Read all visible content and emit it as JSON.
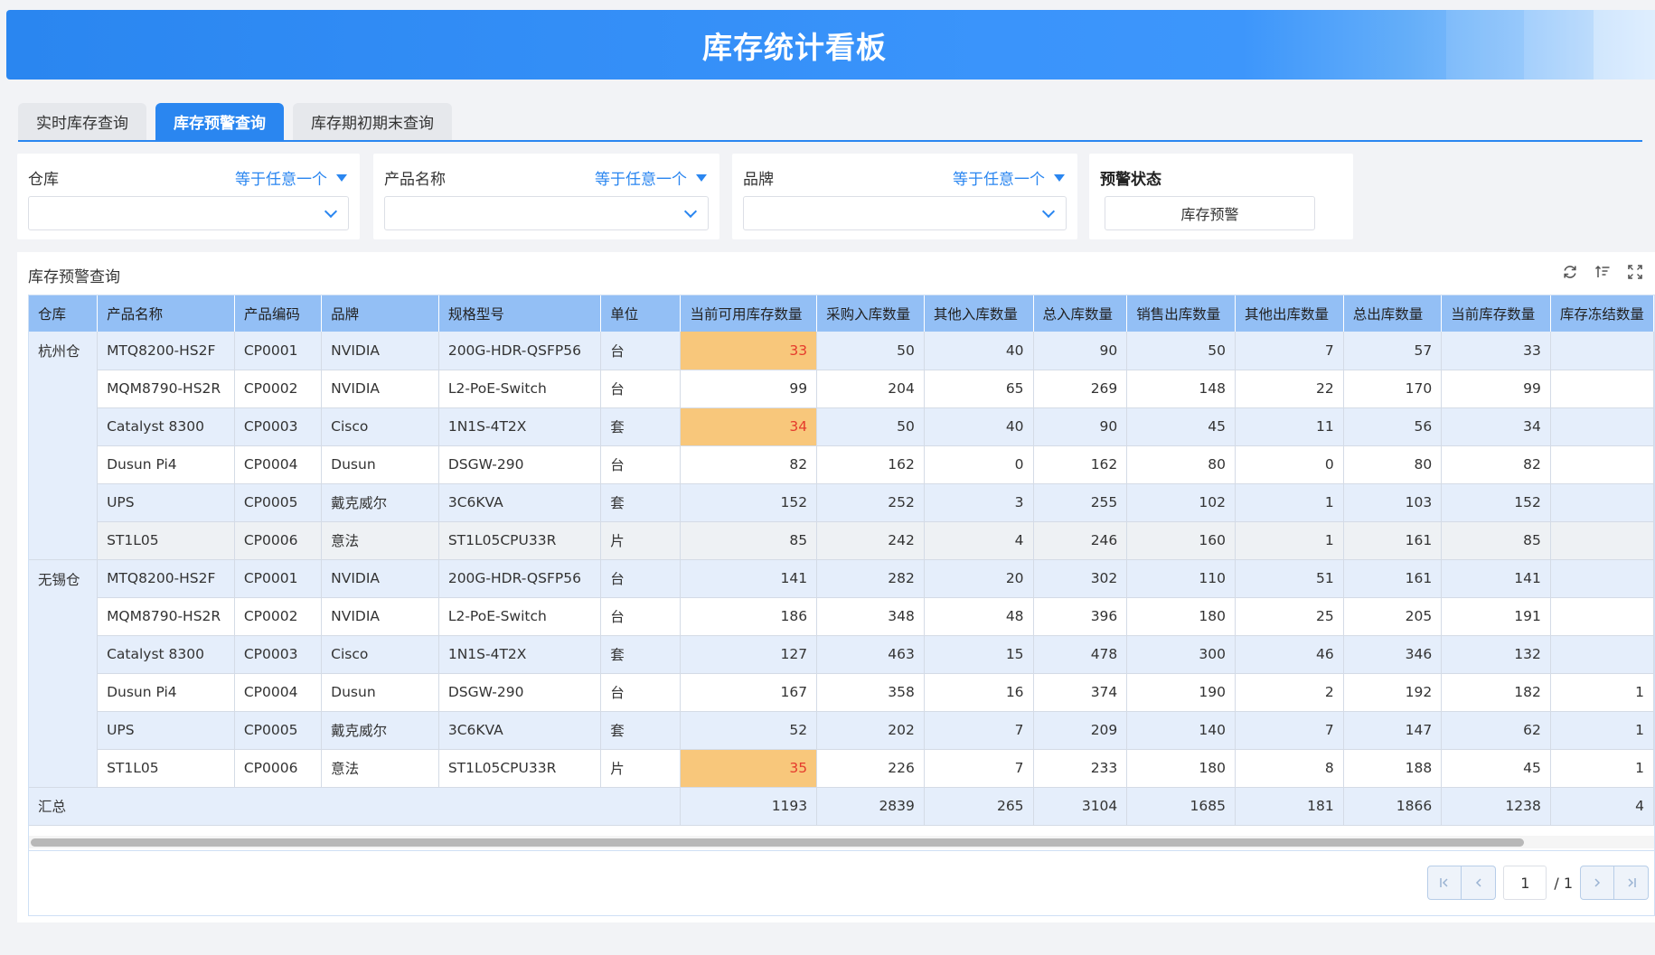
{
  "header": {
    "title": "库存统计看板"
  },
  "tabs": [
    {
      "label": "实时库存查询",
      "active": false
    },
    {
      "label": "库存预警查询",
      "active": true
    },
    {
      "label": "库存期初期末查询",
      "active": false
    }
  ],
  "filters": {
    "warehouse": {
      "label": "仓库",
      "operator": "等于任意一个",
      "value": ""
    },
    "product_name": {
      "label": "产品名称",
      "operator": "等于任意一个",
      "value": ""
    },
    "brand": {
      "label": "品牌",
      "operator": "等于任意一个",
      "value": ""
    },
    "warning_status": {
      "label": "预警状态",
      "button": "库存预警"
    }
  },
  "panel": {
    "title": "库存预警查询",
    "tools": [
      "refresh-icon",
      "sort-icon",
      "fullscreen-icon"
    ]
  },
  "colors": {
    "accent": "#2a86f0",
    "warning_bg": "#f8c77b",
    "warning_text": "#e53b2c",
    "header_bg": "#93bff5"
  },
  "table": {
    "columns": [
      "仓库",
      "产品名称",
      "产品编码",
      "品牌",
      "规格型号",
      "单位",
      "当前可用库存数量",
      "采购入库数量",
      "其他入库数量",
      "总入库数量",
      "销售出库数量",
      "其他出库数量",
      "总出库数量",
      "当前库存数量",
      "库存冻结数量"
    ],
    "groups": [
      {
        "warehouse": "杭州仓",
        "rows": [
          {
            "name": "MTQ8200-HS2F",
            "code": "CP0001",
            "brand": "NVIDIA",
            "spec": "200G-HDR-QSFP56",
            "unit": "台",
            "available": "33",
            "purchase_in": "50",
            "other_in": "40",
            "total_in": "90",
            "sales_out": "50",
            "other_out": "7",
            "total_out": "57",
            "current": "33",
            "frozen": "",
            "warn": true
          },
          {
            "name": "MQM8790-HS2R",
            "code": "CP0002",
            "brand": "NVIDIA",
            "spec": "L2-PoE-Switch",
            "unit": "台",
            "available": "99",
            "purchase_in": "204",
            "other_in": "65",
            "total_in": "269",
            "sales_out": "148",
            "other_out": "22",
            "total_out": "170",
            "current": "99",
            "frozen": "",
            "warn": false
          },
          {
            "name": "Catalyst 8300",
            "code": "CP0003",
            "brand": "Cisco",
            "spec": "1N1S-4T2X",
            "unit": "套",
            "available": "34",
            "purchase_in": "50",
            "other_in": "40",
            "total_in": "90",
            "sales_out": "45",
            "other_out": "11",
            "total_out": "56",
            "current": "34",
            "frozen": "",
            "warn": true
          },
          {
            "name": "Dusun Pi4",
            "code": "CP0004",
            "brand": "Dusun",
            "spec": "DSGW-290",
            "unit": "台",
            "available": "82",
            "purchase_in": "162",
            "other_in": "0",
            "total_in": "162",
            "sales_out": "80",
            "other_out": "0",
            "total_out": "80",
            "current": "82",
            "frozen": "",
            "warn": false
          },
          {
            "name": "UPS",
            "code": "CP0005",
            "brand": "戴克威尔",
            "spec": "3C6KVA",
            "unit": "套",
            "available": "152",
            "purchase_in": "252",
            "other_in": "3",
            "total_in": "255",
            "sales_out": "102",
            "other_out": "1",
            "total_out": "103",
            "current": "152",
            "frozen": "",
            "warn": false
          },
          {
            "name": "ST1L05",
            "code": "CP0006",
            "brand": "意法",
            "spec": "ST1L05CPU33R",
            "unit": "片",
            "available": "85",
            "purchase_in": "242",
            "other_in": "4",
            "total_in": "246",
            "sales_out": "160",
            "other_out": "1",
            "total_out": "161",
            "current": "85",
            "frozen": "",
            "warn": false
          }
        ]
      },
      {
        "warehouse": "无锡仓",
        "rows": [
          {
            "name": "MTQ8200-HS2F",
            "code": "CP0001",
            "brand": "NVIDIA",
            "spec": "200G-HDR-QSFP56",
            "unit": "台",
            "available": "141",
            "purchase_in": "282",
            "other_in": "20",
            "total_in": "302",
            "sales_out": "110",
            "other_out": "51",
            "total_out": "161",
            "current": "141",
            "frozen": "",
            "warn": false
          },
          {
            "name": "MQM8790-HS2R",
            "code": "CP0002",
            "brand": "NVIDIA",
            "spec": "L2-PoE-Switch",
            "unit": "台",
            "available": "186",
            "purchase_in": "348",
            "other_in": "48",
            "total_in": "396",
            "sales_out": "180",
            "other_out": "25",
            "total_out": "205",
            "current": "191",
            "frozen": "",
            "warn": false
          },
          {
            "name": "Catalyst 8300",
            "code": "CP0003",
            "brand": "Cisco",
            "spec": "1N1S-4T2X",
            "unit": "套",
            "available": "127",
            "purchase_in": "463",
            "other_in": "15",
            "total_in": "478",
            "sales_out": "300",
            "other_out": "46",
            "total_out": "346",
            "current": "132",
            "frozen": "",
            "warn": false
          },
          {
            "name": "Dusun Pi4",
            "code": "CP0004",
            "brand": "Dusun",
            "spec": "DSGW-290",
            "unit": "台",
            "available": "167",
            "purchase_in": "358",
            "other_in": "16",
            "total_in": "374",
            "sales_out": "190",
            "other_out": "2",
            "total_out": "192",
            "current": "182",
            "frozen": "1",
            "warn": false
          },
          {
            "name": "UPS",
            "code": "CP0005",
            "brand": "戴克威尔",
            "spec": "3C6KVA",
            "unit": "套",
            "available": "52",
            "purchase_in": "202",
            "other_in": "7",
            "total_in": "209",
            "sales_out": "140",
            "other_out": "7",
            "total_out": "147",
            "current": "62",
            "frozen": "1",
            "warn": false
          },
          {
            "name": "ST1L05",
            "code": "CP0006",
            "brand": "意法",
            "spec": "ST1L05CPU33R",
            "unit": "片",
            "available": "35",
            "purchase_in": "226",
            "other_in": "7",
            "total_in": "233",
            "sales_out": "180",
            "other_out": "8",
            "total_out": "188",
            "current": "45",
            "frozen": "1",
            "warn": true
          }
        ]
      }
    ],
    "summary": {
      "label": "汇总",
      "available": "1193",
      "purchase_in": "2839",
      "other_in": "265",
      "total_in": "3104",
      "sales_out": "1685",
      "other_out": "181",
      "total_out": "1866",
      "current": "1238",
      "frozen": "4"
    }
  },
  "pagination": {
    "current_page": "1",
    "total_label": "/ 1"
  }
}
